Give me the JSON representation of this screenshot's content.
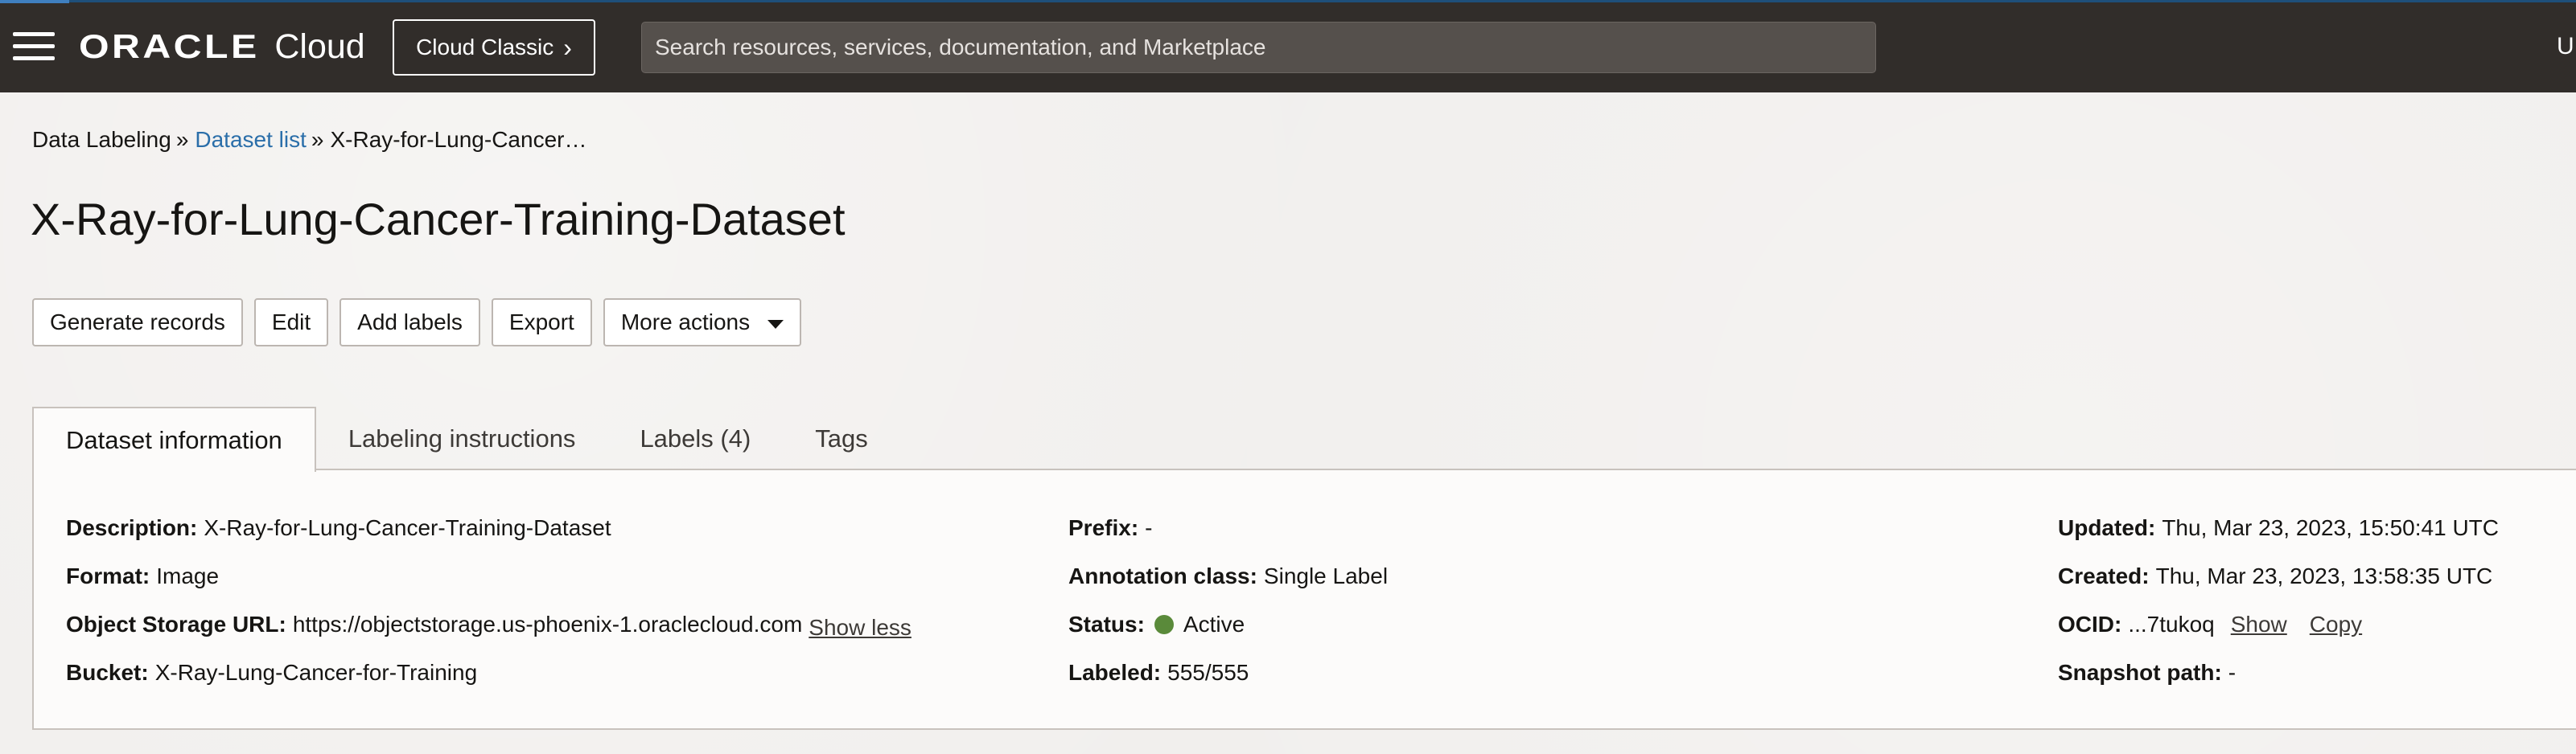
{
  "header": {
    "brand_oracle": "ORACLE",
    "brand_cloud": "Cloud",
    "cloud_classic_label": "Cloud Classic",
    "search_placeholder": "Search resources, services, documentation, and Marketplace",
    "user_initial": "U"
  },
  "breadcrumb": {
    "items": [
      "Data Labeling",
      "Dataset list",
      "X-Ray-for-Lung-Cancer…"
    ],
    "separator": "»"
  },
  "page": {
    "title": "X-Ray-for-Lung-Cancer-Training-Dataset"
  },
  "actions": {
    "generate_records": "Generate records",
    "edit": "Edit",
    "add_labels": "Add labels",
    "export": "Export",
    "more_actions": "More actions"
  },
  "tabs": [
    {
      "label": "Dataset information",
      "active": true
    },
    {
      "label": "Labeling instructions",
      "active": false
    },
    {
      "label": "Labels (4)",
      "active": false
    },
    {
      "label": "Tags",
      "active": false
    }
  ],
  "details": {
    "description_label": "Description:",
    "description_value": "X-Ray-for-Lung-Cancer-Training-Dataset",
    "format_label": "Format:",
    "format_value": "Image",
    "object_storage_label": "Object Storage URL:",
    "object_storage_value": "https://objectstorage.us-phoenix-1.oraclecloud.com",
    "show_less": "Show less",
    "bucket_label": "Bucket:",
    "bucket_value": "X-Ray-Lung-Cancer-for-Training",
    "prefix_label": "Prefix:",
    "prefix_value": "-",
    "annotation_label": "Annotation class:",
    "annotation_value": "Single Label",
    "status_label": "Status:",
    "status_value": "Active",
    "labeled_label": "Labeled:",
    "labeled_value": "555/555",
    "updated_label": "Updated:",
    "updated_value": "Thu, Mar 23, 2023, 15:50:41 UTC",
    "created_label": "Created:",
    "created_value": "Thu, Mar 23, 2023, 13:58:35 UTC",
    "ocid_label": "OCID:",
    "ocid_value": "...7tukoq",
    "show": "Show",
    "copy": "Copy",
    "snapshot_label": "Snapshot path:",
    "snapshot_value": "-"
  },
  "colors": {
    "topbar_bg": "#312d2a",
    "link": "#2a6ea9",
    "status_active": "#5a8a3a",
    "page_bg": "#f1efed"
  }
}
